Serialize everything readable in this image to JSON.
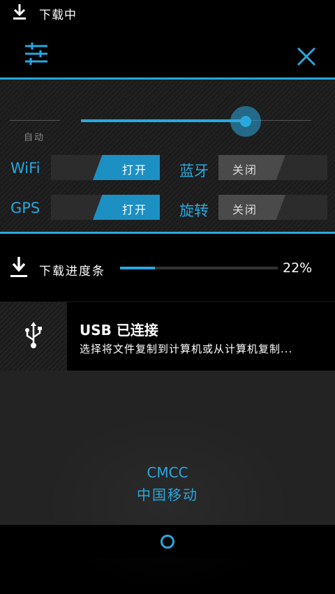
{
  "status_bar": {
    "text": "下载中",
    "icon": "download-icon"
  },
  "header": {
    "settings_icon": "settings-sliders-icon",
    "close_icon": "close-icon"
  },
  "brightness": {
    "auto_label": "自动",
    "level": 0.7
  },
  "toggles": {
    "wifi": {
      "label": "WiFi",
      "state_text": "打开",
      "state": "on"
    },
    "bluetooth": {
      "label": "蓝牙",
      "state_text": "关闭",
      "state": "off"
    },
    "gps": {
      "label": "GPS",
      "state_text": "打开",
      "state": "on"
    },
    "rotation": {
      "label": "旋转",
      "state_text": "关闭",
      "state": "off"
    }
  },
  "download": {
    "label": "下载进度条",
    "percent_text": "22%",
    "progress": 0.22
  },
  "usb": {
    "title": "USB 已连接",
    "subtitle": "选择将文件复制到计算机或从计算机复制...",
    "icon": "usb-icon"
  },
  "carrier": {
    "name": "CMCC",
    "name_cn": "中国移动"
  },
  "bottom_bar": {
    "home_icon": "home-circle-icon"
  },
  "colors": {
    "accent": "#29a8df",
    "toggle_on": "#1c8fc3",
    "toggle_off": "#4a4a4a"
  }
}
